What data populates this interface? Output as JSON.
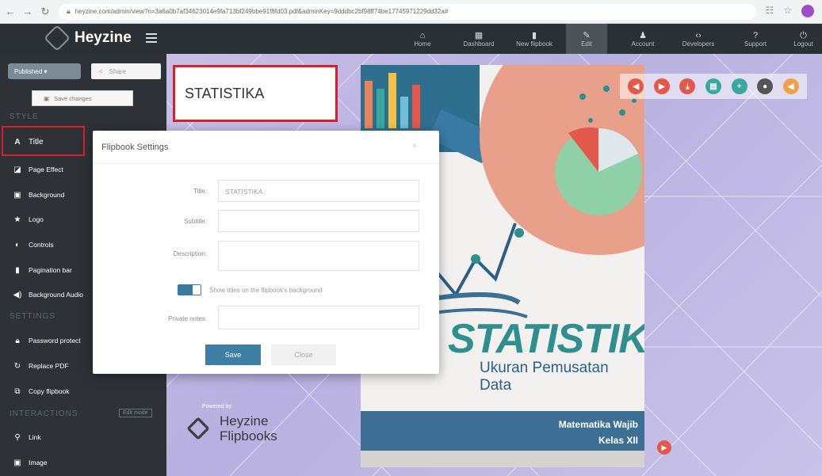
{
  "browser": {
    "url": "heyzine.com/admin/view?n=3a6a0b7af34623014e9fa713bf249bbe91f8fd03.pdf&adminKey=9dddbc2bf98ff74be17745971229dd32a#",
    "icons": [
      "back-arrow-icon",
      "forward-arrow-icon",
      "reload-icon",
      "lock-icon",
      "reader-icon",
      "star-icon",
      "extension-icon"
    ]
  },
  "topnav": {
    "brand": "Heyzine",
    "items": [
      {
        "label": "Home",
        "icon": "home-icon"
      },
      {
        "label": "Dashboard",
        "icon": "dashboard-icon"
      },
      {
        "label": "New flipbook",
        "icon": "new-file-icon"
      },
      {
        "label": "Edit",
        "icon": "pencil-icon"
      },
      {
        "label": "Account",
        "icon": "user-icon"
      },
      {
        "label": "Developers",
        "icon": "code-icon"
      },
      {
        "label": "Support",
        "icon": "support-icon"
      },
      {
        "label": "Logout",
        "icon": "power-icon"
      }
    ],
    "active": "Edit"
  },
  "sidebar": {
    "published_label": "Published ▾",
    "share_label": "Share",
    "save_changes_label": "Save changes",
    "style_header": "STYLE",
    "settings_header": "SETTINGS",
    "interactions_header": "INTERACTIONS",
    "edit_mode_label": "Edit mode",
    "items": [
      {
        "label": "Title",
        "icon": "title-a-icon"
      },
      {
        "label": "Page Effect",
        "icon": "page-effect-icon"
      },
      {
        "label": "Background",
        "icon": "image-icon"
      },
      {
        "label": "Logo",
        "icon": "star-icon"
      },
      {
        "label": "Controls",
        "icon": "toggle-icon"
      },
      {
        "label": "Pagination bar",
        "icon": "bookmark-icon"
      },
      {
        "label": "Background Audio",
        "icon": "speaker-icon"
      },
      {
        "label": "Password protect",
        "icon": "lock-icon"
      },
      {
        "label": "Replace PDF",
        "icon": "refresh-icon"
      },
      {
        "label": "Copy flipbook",
        "icon": "copy-icon"
      },
      {
        "label": "Link",
        "icon": "link-icon"
      },
      {
        "label": "Image",
        "icon": "image-icon"
      }
    ]
  },
  "stage": {
    "title_text": "STATISTIKA",
    "powered_by": "Powered by",
    "powered_name_1": "Heyzine",
    "powered_name_2": "Flipbooks"
  },
  "book": {
    "title": "STATISTIKA",
    "subtitle": "Ukuran Pemusatan Data",
    "footer_1": "Matematika Wajib",
    "footer_2": "Kelas XII"
  },
  "controls": [
    {
      "icon": "prev-icon",
      "color": "#e4584b"
    },
    {
      "icon": "next-icon",
      "color": "#e4584b"
    },
    {
      "icon": "download-icon",
      "color": "#e4584b"
    },
    {
      "icon": "print-icon",
      "color": "#3aa7a0"
    },
    {
      "icon": "zoom-in-icon",
      "color": "#3aa7a0"
    },
    {
      "icon": "settings-icon",
      "color": "#555555"
    },
    {
      "icon": "sound-icon",
      "color": "#f0a04b"
    }
  ],
  "modal": {
    "title": "Flipbook Settings",
    "close_x": "×",
    "title_label": "Title:",
    "title_value": "STATISTIKA",
    "subtitle_label": "Subtitle:",
    "subtitle_value": "",
    "description_label": "Description:",
    "description_value": "",
    "toggle_label": "Show titles on the flipbook's background",
    "private_label": "Private notes:",
    "private_value": "",
    "save_label": "Save",
    "close_label": "Close"
  }
}
